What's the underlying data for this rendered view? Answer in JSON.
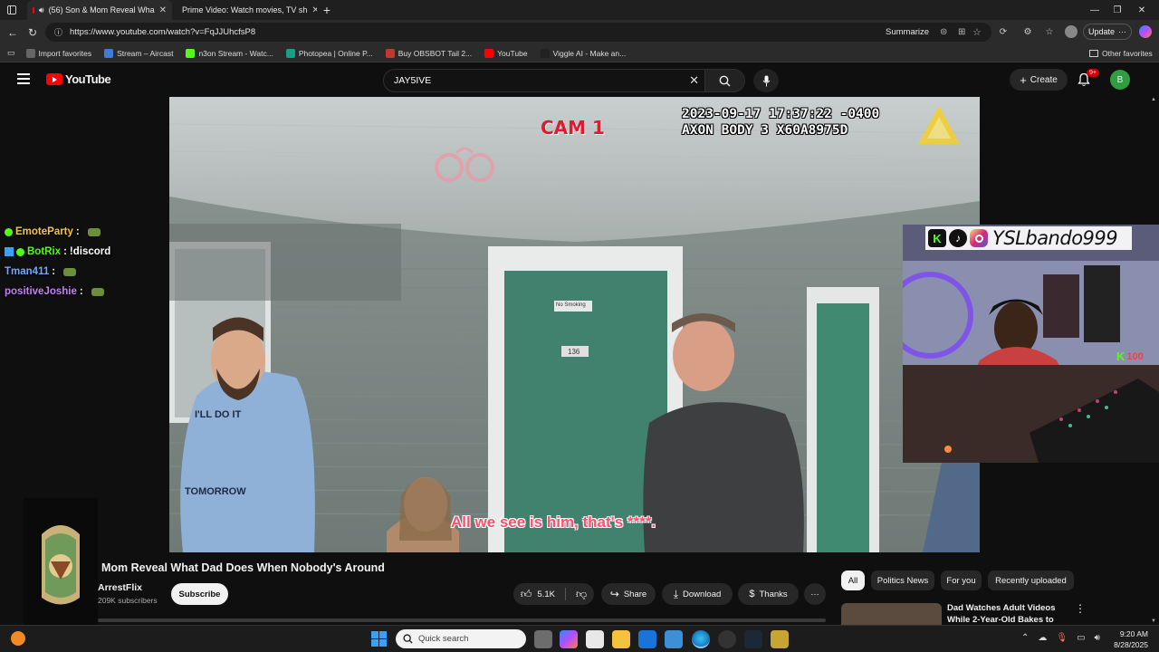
{
  "browser": {
    "tabs": [
      {
        "title": "(56) Son & Mom Reveal Wha"
      },
      {
        "title": "Prime Video: Watch movies, TV sh"
      }
    ],
    "url": "https://www.youtube.com/watch?v=FqJJUhcfsP8",
    "summarize_label": "Summarize",
    "update_label": "Update",
    "favorites": [
      {
        "label": "Import favorites",
        "color": "#666666"
      },
      {
        "label": "Stream – Aircast",
        "color": "#3d7bd9"
      },
      {
        "label": "n3on Stream - Watc...",
        "color": "#53fc18"
      },
      {
        "label": "Photopea | Online P...",
        "color": "#16a085"
      },
      {
        "label": "Buy OBSBOT Tail 2...",
        "color": "#c0392b"
      },
      {
        "label": "YouTube",
        "color": "#ff0000"
      },
      {
        "label": "Viggle AI - Make an...",
        "color": "#222222"
      }
    ],
    "other_favorites": "Other favorites"
  },
  "youtube": {
    "logo_text": "YouTube",
    "search_query": "JAY5IVE",
    "create_label": "Create",
    "notification_count": "9+",
    "avatar_letter": "B"
  },
  "video_overlay": {
    "cam_label": "CAM 1",
    "timestamp": "2023-09-17 17:37:22 -0400",
    "device": "AXON BODY 3 X60A8975D",
    "subtitle": "All we see is him, that's ****.",
    "door_sign": "No Smoking",
    "door_number": "136",
    "shirt_text_top": "I'LL DO IT",
    "shirt_text_bottom": "TOMORROW"
  },
  "stream_overlay": {
    "handle": "YSLbando999",
    "kick_count": "100",
    "chat": [
      {
        "user": "EmoteParty",
        "msg": "",
        "color": "#f5c542",
        "badges": [
          "verified"
        ]
      },
      {
        "user": "BotRix",
        "msg": "!discord",
        "color": "#53fc18",
        "badges": [
          "bot",
          "verified"
        ]
      },
      {
        "user": "Tman411",
        "msg": "",
        "color": "#6fa8ff",
        "badges": []
      },
      {
        "user": "positiveJoshie",
        "msg": "",
        "color": "#c77dff",
        "badges": []
      }
    ]
  },
  "video_info": {
    "title": "Mom Reveal What Dad Does When Nobody's Around",
    "channel": "ArrestFlix",
    "subscribers": "209K subscribers",
    "subscribe_label": "Subscribe",
    "likes": "5.1K",
    "share_label": "Share",
    "download_label": "Download",
    "thanks_label": "Thanks"
  },
  "recommendations": {
    "chips": [
      "All",
      "Politics News",
      "For you",
      "Recently uploaded"
    ],
    "first_title_line1": "Dad Watches Adult Videos",
    "first_title_line2": "While 2-Year-Old Bakes to"
  },
  "taskbar": {
    "search_placeholder": "Quick search",
    "time": "9:20 AM",
    "date": "8/28/2025"
  }
}
